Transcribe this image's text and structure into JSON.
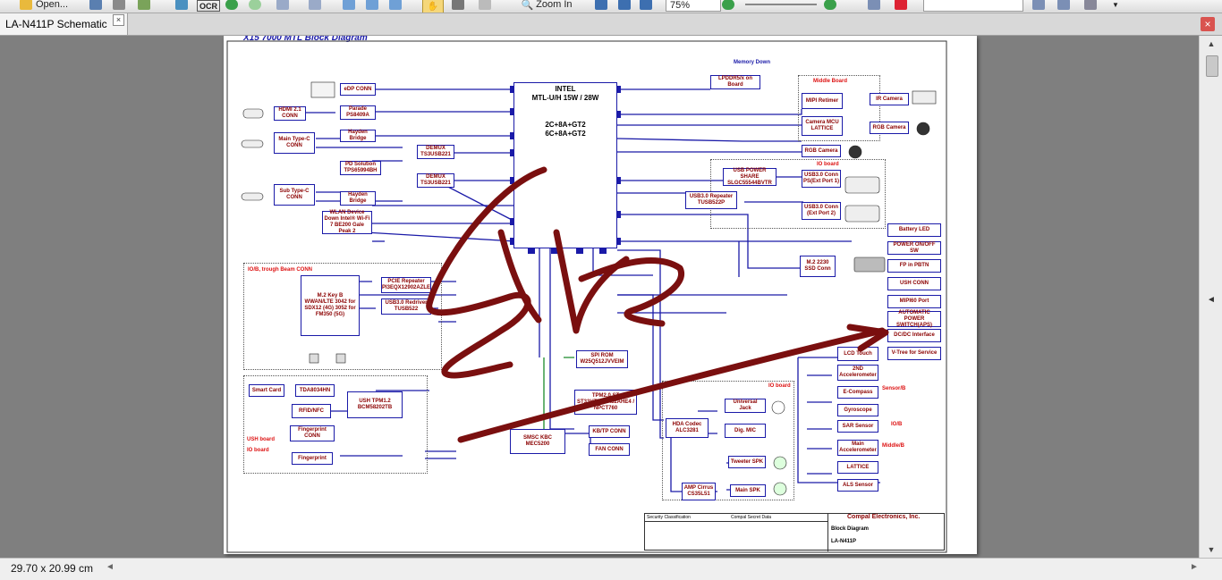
{
  "toolbar": {
    "open_label": "Open...",
    "ocr_label": "OCR",
    "zoom_in_label": "Zoom In",
    "zoom_value": "75%",
    "search_value": ""
  },
  "tab": {
    "label": "LA-N411P Schematic",
    "close": "×"
  },
  "window_close": "×",
  "status": {
    "page_size": "29.70 x 20.99 cm"
  },
  "schematic": {
    "title": "X15 7000 MTL Block Diagram",
    "cpu": {
      "line1": "INTEL",
      "line2": "MTL-U/H 15W / 28W",
      "line3": "2C+8A+GT2",
      "line4": "6C+8A+GT2"
    },
    "blocks": {
      "edp": "eDP CONN",
      "hdmi": "HDMI 2.1 CONN",
      "parade": "Parade PS8409A",
      "main_typec": "Main Type-C CONN",
      "hayden1": "Hayden Bridge",
      "pd": "PD Solution TPS65994BH",
      "demux1": "DEMUX TS3USB221",
      "demux2": "DEMUX TS3USB221",
      "sub_typec": "Sub Type-C CONN",
      "hayden2": "Hayden Bridge",
      "wlan": "WLAN Device Down Intel® Wi-Fi 7 BE200 Gale Peak 2",
      "m2_wwan": "M.2 Key B WWAN/LTE 3042 for SDX12 (4G) 3052 for FM350 (5G)",
      "pcie_rep": "PCIE Repeater PI3EQX12902AZLE",
      "usb_redriver": "USB3.0 Redriver TUSB522",
      "smart_card": "Smart Card",
      "tda": "TDA8034HN",
      "ush": "USH TPM1.2 BCM58202TB",
      "rfid": "RFID/NFC",
      "fp_conn": "Fingerprint CONN",
      "fingerprint": "Fingerprint",
      "lpddr": "LPDDR5/x on Board",
      "mipi_ret": "MIPI Retimer",
      "camera_mcu": "Camera MCU LATTICE",
      "ir_cam": "IR Camera",
      "rgb_cam": "RGB Camera",
      "rgb_cam2": "RGB Camera",
      "usb_power_share": "USB POWER SHARE SLGC55544BVTR",
      "usb3_conn1": "USB3.0 Conn PS(Ext Port 1)",
      "usb3_rep": "USB3.0 Repeater TUSB522P",
      "usb3_conn2": "USB3.0 Conn (Ext Port 2)",
      "ssd": "M.2 2230 SSD Conn",
      "battery_led": "Battery LED",
      "power_sw": "POWER ON/OFF SW",
      "fp_pbtn": "FP in PBTN",
      "ush_conn": "USH CONN",
      "mipi60": "MIPI60 Port",
      "auto_power": "AUTOMATIC POWER SWITCH(APS)",
      "dcdc": "DC/DC Interface",
      "vtree": "V-Tree for Service",
      "spi_rom": "SPI ROM W25Q512JVVEIM",
      "tpm": "TPM2.0 ST ST33HTPH2X32AHE4 / NPCT760",
      "hda": "HDA Codec ALC3281",
      "smsc": "SMSC KBC MEC5200",
      "kb_tp": "KB/TP CONN",
      "fan": "FAN CONN",
      "universal_jack": "Universal Jack",
      "dig_mic": "Dig. MIC",
      "tweeter": "Tweeter SPK",
      "amp": "AMP Cirrus CS35L51",
      "main_spk": "Main SPK",
      "lcd_touch": "LCD Touch",
      "accel2": "2ND Accelerometer",
      "ecompass": "E-Compass",
      "gyro": "Gyroscope",
      "sar": "SAR Sensor",
      "main_accel": "Main Accelerometer",
      "lattice": "LATTICE",
      "als": "ALS Sensor"
    },
    "boards": {
      "middle": "Middle Board",
      "io": "IO board",
      "io_b_trough": "IO/B, trough Beam CONN",
      "ush_board": "USH board",
      "io_board2": "IO board",
      "io_board3": "IO board",
      "sensor_b": "Sensor/B",
      "io_b": "IO/B",
      "middle_b": "Middle/B"
    },
    "memory_down": "Memory Down",
    "titleblock": {
      "company": "Compal Electronics, Inc.",
      "doc": "Block Diagram",
      "model": "LA-N411P",
      "classification": "Security Classification",
      "secret": "Compal Secret Data"
    },
    "handwriting_color": "#7a0f0f",
    "line_color": "#1a1aa8",
    "text_color": "#8b0000"
  }
}
